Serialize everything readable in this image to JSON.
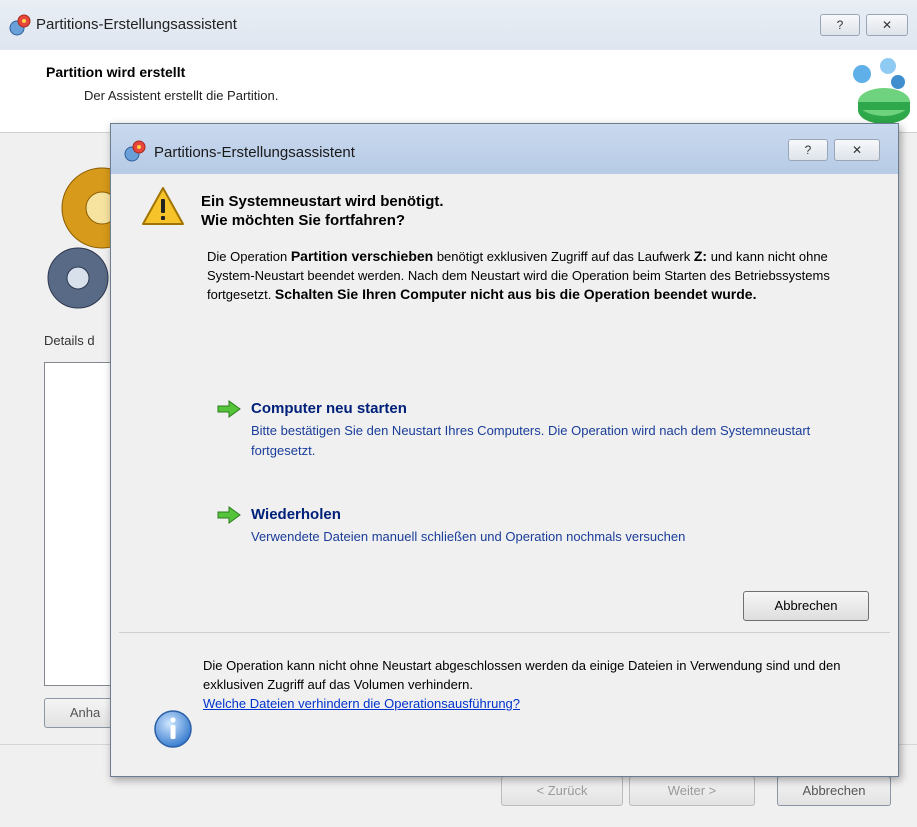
{
  "background_window": {
    "title": "Partitions-Erstellungsassistent",
    "title_buttons": {
      "help": "?",
      "close": "✕"
    },
    "header_title": "Partition wird erstellt",
    "header_subtitle": "Der Assistent erstellt die Partition.",
    "details_label": "Details d",
    "anhang_button": "Anha",
    "back_button": "< Zurück",
    "next_button": "Weiter >",
    "cancel_button": "Abbrechen"
  },
  "dialog": {
    "title": "Partitions-Erstellungsassistent",
    "title_buttons": {
      "help": "?",
      "close": "✕"
    },
    "heading_line1": "Ein Systemneustart wird benötigt.",
    "heading_line2": "Wie möchten Sie fortfahren?",
    "message": {
      "part1": "Die Operation ",
      "bold1": "Partition verschieben",
      "part2": " benötigt exklusiven Zugriff auf das Laufwerk ",
      "bold2": "Z:",
      "part3": " und kann nicht ohne System-Neustart beendet werden. Nach dem Neustart wird die Operation beim Starten des Betriebssystems fortgesetzt. ",
      "bold3": "Schalten Sie Ihren Computer nicht aus bis die Operation beendet wurde."
    },
    "commands": [
      {
        "title": "Computer neu starten",
        "description": "Bitte bestätigen Sie den Neustart Ihres Computers. Die Operation wird nach dem Systemneustart fortgesetzt."
      },
      {
        "title": "Wiederholen",
        "description": "Verwendete Dateien manuell schließen und Operation nochmals versuchen"
      }
    ],
    "cancel_button": "Abbrechen",
    "info_text": "Die Operation kann nicht ohne Neustart abgeschlossen werden da einige Dateien in Verwendung sind und den exklusiven Zugriff auf das Volumen verhindern.",
    "info_link": "Welche Dateien verhindern die Operationsausführung?"
  },
  "icons": [
    "app-icon",
    "warning-icon",
    "arrow-right-icon",
    "info-icon",
    "gear-icon",
    "wizard-graphic-icon"
  ],
  "colors": {
    "command_title": "#00207a",
    "command_desc": "#1a3d9a",
    "link": "#0033cc"
  }
}
